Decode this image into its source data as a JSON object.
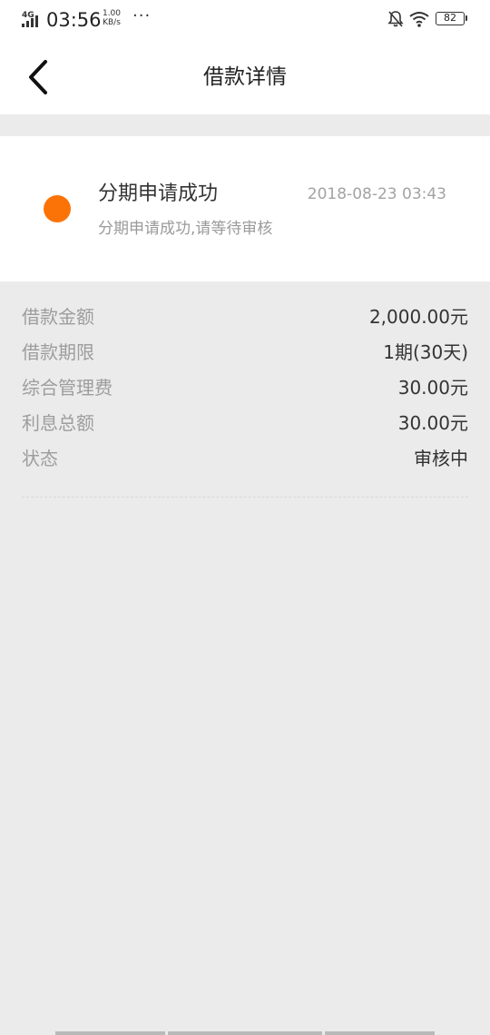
{
  "status_bar": {
    "network": "4G",
    "time": "03:56",
    "speed_value": "1.00",
    "speed_unit": "KB/s",
    "more": "···",
    "battery": "82"
  },
  "nav": {
    "title": "借款详情"
  },
  "status_card": {
    "title": "分期申请成功",
    "time": "2018-08-23 03:43",
    "description": "分期申请成功,请等待审核",
    "dot_color": "#fb7307"
  },
  "details": [
    {
      "label": "借款金额",
      "value": "2,000.00元"
    },
    {
      "label": "借款期限",
      "value": "1期(30天)"
    },
    {
      "label": "综合管理费",
      "value": "30.00元"
    },
    {
      "label": "利息总额",
      "value": "30.00元"
    },
    {
      "label": "状态",
      "value": "审核中"
    }
  ],
  "icons": {
    "back": "chevron-left-icon",
    "mute": "bell-off-icon",
    "wifi": "wifi-icon",
    "signal": "signal-icon",
    "battery": "battery-icon"
  }
}
